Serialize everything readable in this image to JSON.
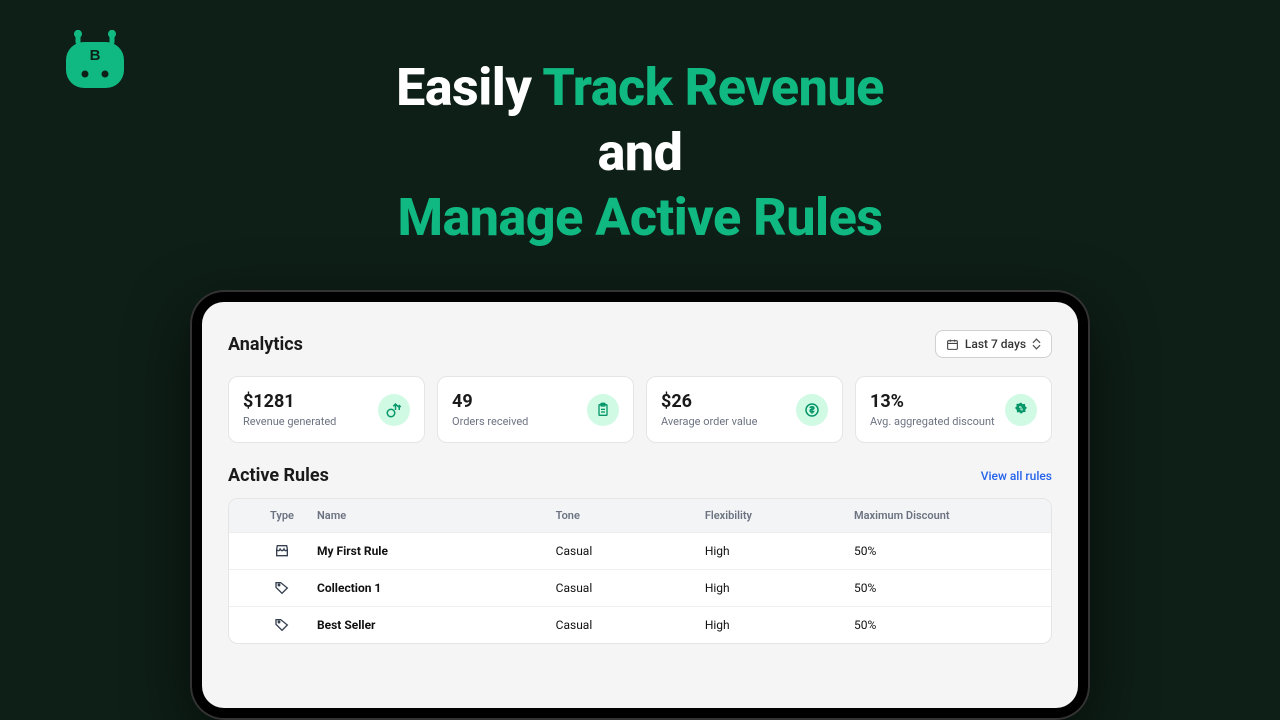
{
  "headline": {
    "part1": "Easily ",
    "part2": "Track Revenue",
    "part3": "and",
    "part4": "Manage Active Rules"
  },
  "analytics": {
    "title": "Analytics",
    "filter_label": "Last 7 days",
    "stats": [
      {
        "value": "$1281",
        "label": "Revenue generated"
      },
      {
        "value": "49",
        "label": "Orders received"
      },
      {
        "value": "$26",
        "label": "Average order value"
      },
      {
        "value": "13%",
        "label": "Avg. aggregated discount"
      }
    ]
  },
  "rules": {
    "title": "Active Rules",
    "view_all": "View all rules",
    "columns": {
      "type": "Type",
      "name": "Name",
      "tone": "Tone",
      "flexibility": "Flexibility",
      "max_discount": "Maximum Discount"
    },
    "rows": [
      {
        "icon": "store",
        "name": "My First Rule",
        "tone": "Casual",
        "flexibility": "High",
        "max_discount": "50%"
      },
      {
        "icon": "tag",
        "name": "Collection 1",
        "tone": "Casual",
        "flexibility": "High",
        "max_discount": "50%"
      },
      {
        "icon": "tag",
        "name": "Best Seller",
        "tone": "Casual",
        "flexibility": "High",
        "max_discount": "50%"
      }
    ]
  }
}
